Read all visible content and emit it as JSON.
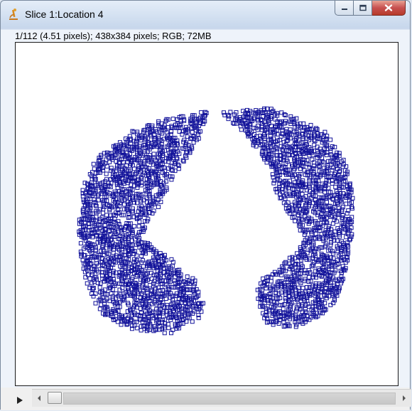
{
  "window": {
    "title": "Slice 1:Location 4",
    "info_line": "1/112 (4.51 pixels); 438x384 pixels; RGB; 72MB",
    "app_icon": "imagej-microscope-icon"
  },
  "caption_buttons": {
    "minimize_icon": "minimize-icon",
    "maximize_icon": "maximize-icon",
    "close_icon": "close-icon"
  },
  "image": {
    "description_icon": "lung-mask-overlay",
    "box_color": "#12129a",
    "background": "#ffffff"
  },
  "scrollbar": {
    "left_arrow": "scroll-left-icon",
    "right_arrow": "scroll-right-icon",
    "position": 0
  },
  "animation": {
    "play_icon": "play-icon"
  }
}
